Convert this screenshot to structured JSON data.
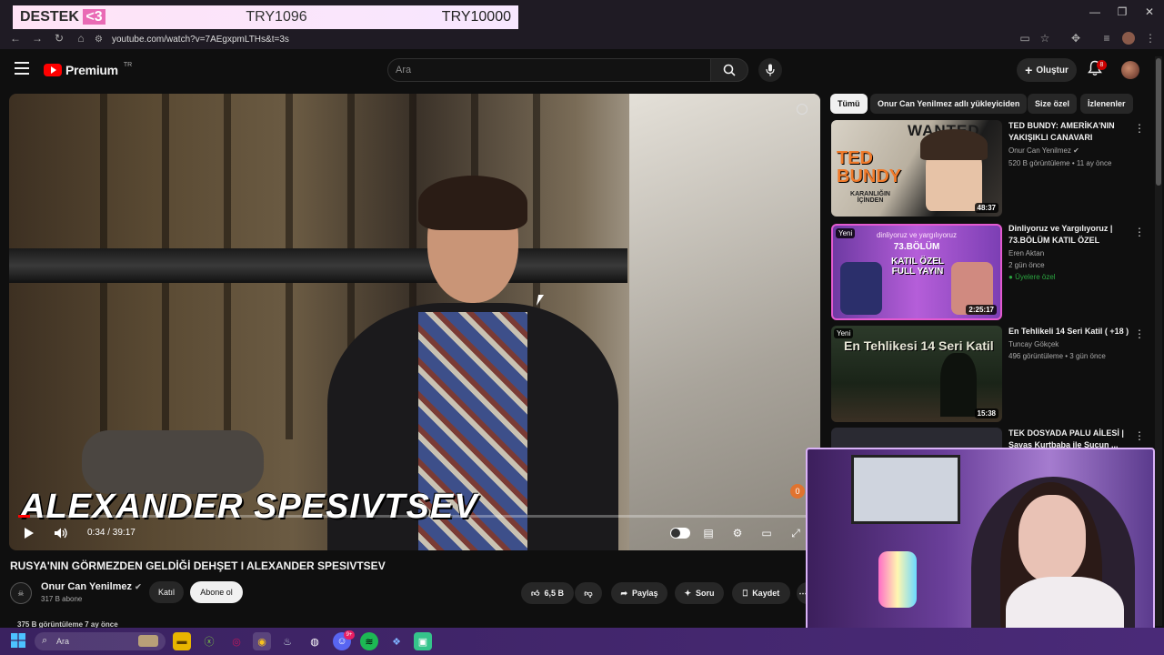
{
  "stream_overlay": {
    "label_prefix": "DESTEK",
    "label_emoji": "<3",
    "current": "TRY1096",
    "goal": "TRY10000"
  },
  "browser": {
    "url": "youtube.com/watch?v=7AEgxpmLTHs&t=3s"
  },
  "header": {
    "logo_text": "Premium",
    "logo_region": "TR",
    "search_placeholder": "Ara",
    "create_label": "Oluştur",
    "notification_count": "8"
  },
  "player": {
    "overlay_title": "ALEXANDER SPESIVTSEV",
    "time": "0:34 / 39:17",
    "progress": 0.0144,
    "brand_badge": "0"
  },
  "video": {
    "title": "RUSYA'NIN GÖRMEZDEN GELDİĞİ DEHŞET I ALEXANDER SPESIVTSEV",
    "channel": "Onur Can Yenilmez",
    "subscribers": "317 B abone",
    "join_label": "Katıl",
    "subscribe_label": "Abone ol",
    "likes": "6,5 B",
    "share_label": "Paylaş",
    "ask_label": "Soru",
    "save_label": "Kaydet",
    "views": "375 B görüntüleme  7 ay önce"
  },
  "chips": [
    "Tümü",
    "Onur Can Yenilmez adlı yükleyiciden",
    "Size özel",
    "İzlenenler"
  ],
  "recommendations": [
    {
      "title": "TED BUNDY: AMERİKA'NIN YAKIŞIKLI CANAVARI",
      "channel": "Onur Can Yenilmez",
      "meta": "520 B görüntüleme • 11 ay önce",
      "duration": "48:37",
      "thumb_text": "TED BUNDY",
      "thumb_sub": "KARANLIĞIN İÇİNDEN",
      "thumb_wanted": "WANTED"
    },
    {
      "title": "Dinliyoruz ve Yargılıyoruz | 73.BÖLÜM KATIL ÖZEL",
      "channel": "Eren Aktan",
      "meta": "2 gün önce",
      "extra": "Üyelere özel",
      "duration": "2:25:17",
      "new_label": "Yeni",
      "thumb_text": "KATIL ÖZEL FULL YAYIN",
      "thumb_sub": "73.BÖLÜM",
      "thumb_top": "dinliyoruz  ve  yargılıyoruz"
    },
    {
      "title": "En Tehlikeli 14 Seri Katil ( +18 )",
      "channel": "Tuncay Gökçek",
      "meta": "496 görüntüleme • 3 gün önce",
      "duration": "15:38",
      "new_label": "Yeni",
      "thumb_text": "En Tehlikesi 14 Seri Katil"
    },
    {
      "title": "TEK DOSYADA PALU AİLESİ | Savaş Kurtbaba ile Suçun ...",
      "channel": "",
      "meta": ""
    }
  ],
  "taskbar": {
    "search_placeholder": "Ara",
    "discord_badge": "9+"
  },
  "colors": {
    "accent": "#ff0000",
    "overlay_pink": "#e96ab5",
    "taskbar": "#3a2260",
    "member_green": "#2ba640"
  }
}
